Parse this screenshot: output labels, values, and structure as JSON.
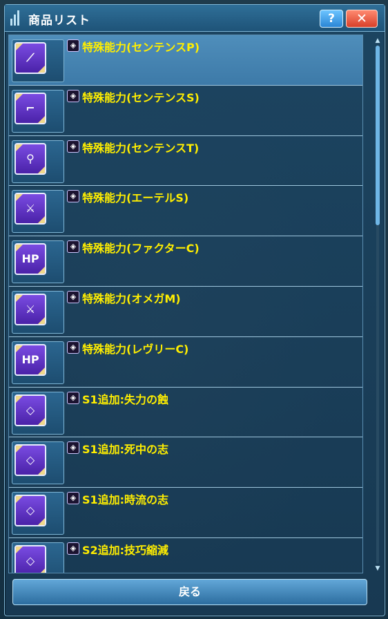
{
  "window": {
    "title": "商品リスト",
    "help_label": "?",
    "close_label": "✕"
  },
  "items": [
    {
      "name": "特殊能力(センテンスP)",
      "icon": "sword-icon",
      "icon_text": ""
    },
    {
      "name": "特殊能力(センテンスS)",
      "icon": "gun-icon",
      "icon_text": ""
    },
    {
      "name": "特殊能力(センテンスT)",
      "icon": "wand-icon",
      "icon_text": ""
    },
    {
      "name": "特殊能力(エーテルS)",
      "icon": "mixed-weapons-icon",
      "icon_text": ""
    },
    {
      "name": "特殊能力(ファクターC)",
      "icon": "hp-icon",
      "icon_text": "HP"
    },
    {
      "name": "特殊能力(オメガM)",
      "icon": "mixed-weapons-icon",
      "icon_text": ""
    },
    {
      "name": "特殊能力(レヴリーC)",
      "icon": "hp-icon",
      "icon_text": "HP"
    },
    {
      "name": "S1追加:失力の蝕",
      "icon": "ability-icon",
      "icon_text": ""
    },
    {
      "name": "S1追加:死中の志",
      "icon": "ability-icon",
      "icon_text": ""
    },
    {
      "name": "S1追加:時流の志",
      "icon": "ability-icon",
      "icon_text": ""
    },
    {
      "name": "S2追加:技巧縮減",
      "icon": "ability-icon",
      "icon_text": ""
    }
  ],
  "footer": {
    "back_label": "戻る"
  },
  "colors": {
    "item_text": "#ffee00",
    "selected_row": "#4f8ebb",
    "icon_bg": "#6a3fd6"
  }
}
